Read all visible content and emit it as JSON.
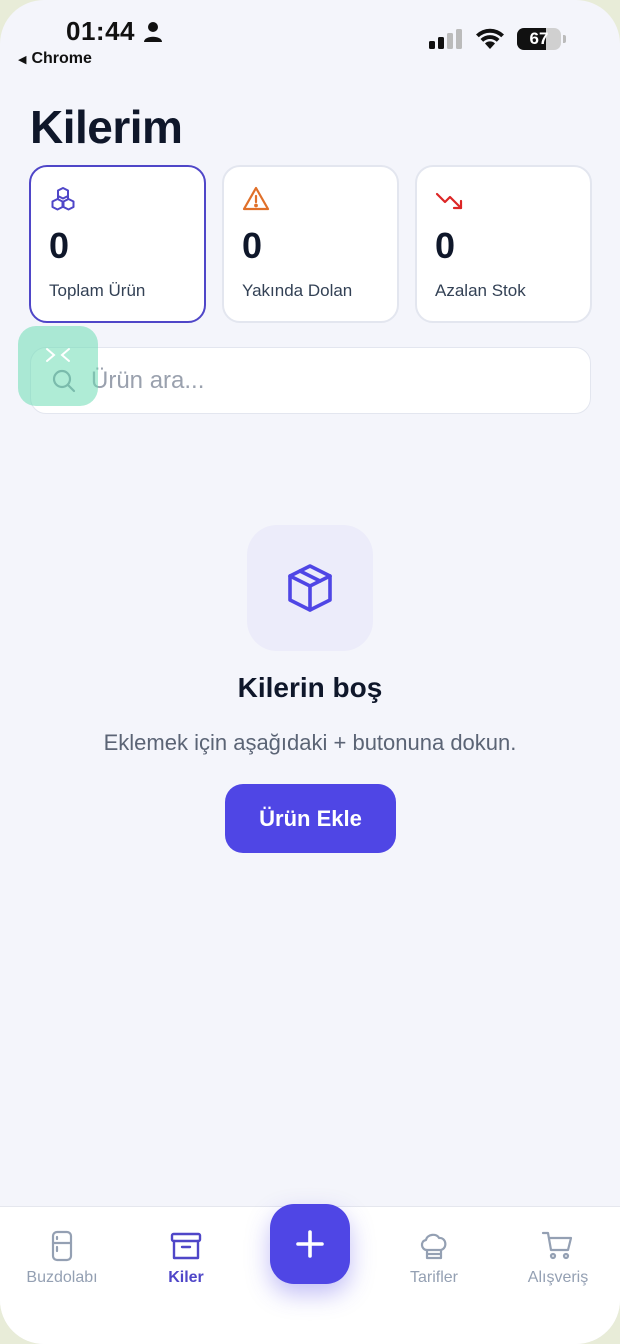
{
  "status_bar": {
    "time": "01:44",
    "back_app": "Chrome",
    "battery": "67",
    "battery_level": 0.67
  },
  "header": {
    "title": "Kilerim"
  },
  "stats": [
    {
      "value": "0",
      "label": "Toplam Ürün",
      "icon": "cubes-icon",
      "color": "#4f46c8"
    },
    {
      "value": "0",
      "label": "Yakında Dolan",
      "icon": "warning-triangle-icon",
      "color": "#e0702a"
    },
    {
      "value": "0",
      "label": "Azalan Stok",
      "icon": "trending-down-icon",
      "color": "#dc2626"
    }
  ],
  "search": {
    "placeholder": "Ürün ara..."
  },
  "empty_state": {
    "title": "Kilerin boş",
    "description": "Eklemek için aşağıdaki + butonuna dokun.",
    "button_label": "Ürün Ekle"
  },
  "tabbar": {
    "items": [
      {
        "label": "Buzdolabı",
        "icon": "fridge-icon",
        "active": false
      },
      {
        "label": "Kiler",
        "icon": "archive-box-icon",
        "active": true
      },
      {
        "label": "Tarifler",
        "icon": "chef-hat-icon",
        "active": false
      },
      {
        "label": "Alışveriş",
        "icon": "cart-icon",
        "active": false
      }
    ],
    "fab_icon": "plus-icon"
  },
  "colors": {
    "accent": "#4f46e5",
    "background": "#f4f5fb",
    "text": "#0f172a"
  }
}
